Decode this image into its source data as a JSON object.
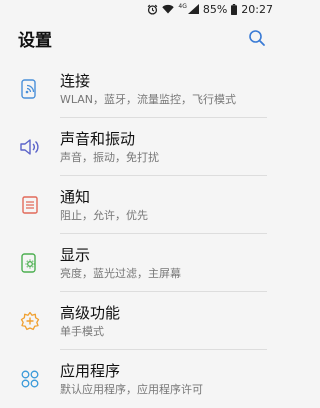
{
  "status_bar": {
    "network": "4G",
    "battery": "85%",
    "time": "20:27"
  },
  "header": {
    "title": "设置",
    "search_icon": "search-icon"
  },
  "items": [
    {
      "label": "连接",
      "sub": "WLAN，蓝牙，流量监控，飞行模式",
      "icon": "connections-icon",
      "color": "#4a90d9"
    },
    {
      "label": "声音和振动",
      "sub": "声音，振动，免打扰",
      "icon": "speaker-icon",
      "color": "#5b63c9"
    },
    {
      "label": "通知",
      "sub": "阻止，允许，优先",
      "icon": "notification-icon",
      "color": "#e26a5a"
    },
    {
      "label": "显示",
      "sub": "亮度，蓝光过滤，主屏幕",
      "icon": "display-icon",
      "color": "#4caf50"
    },
    {
      "label": "高级功能",
      "sub": "单手模式",
      "icon": "advanced-features-icon",
      "color": "#f0a030"
    },
    {
      "label": "应用程序",
      "sub": "默认应用程序，应用程序许可",
      "icon": "apps-icon",
      "color": "#3a9ad9"
    }
  ],
  "colors": {
    "background": "#f5f5f5",
    "accent": "#3a7bd5"
  }
}
